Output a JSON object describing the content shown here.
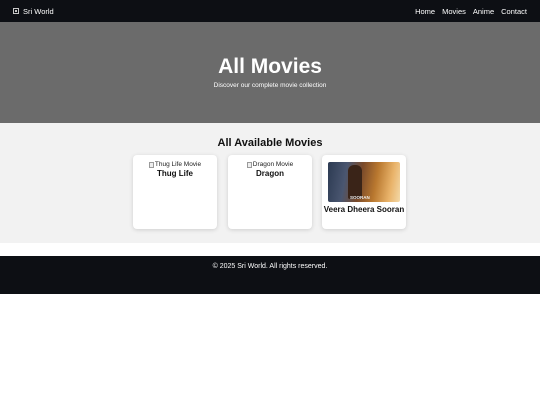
{
  "nav": {
    "brand": "Sri World",
    "links": [
      "Home",
      "Movies",
      "Anime",
      "Contact"
    ]
  },
  "hero": {
    "title": "All Movies",
    "subtitle": "Discover our complete movie collection"
  },
  "section": {
    "title": "All Available Movies"
  },
  "movies": [
    {
      "alt": "Thug Life Movie",
      "title": "Thug Life",
      "image_loaded": false
    },
    {
      "alt": "Dragon Movie",
      "title": "Dragon",
      "image_loaded": false
    },
    {
      "title": "Veera Dheera Sooran",
      "image_loaded": true,
      "poster_text": "SOORAN"
    }
  ],
  "footer": {
    "text": "© 2025 Sri World. All rights reserved."
  },
  "colors": {
    "navbar": "#0d0f14",
    "hero": "#6b6b6b",
    "section_bg": "#f2f2f2"
  }
}
